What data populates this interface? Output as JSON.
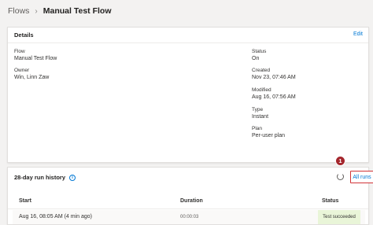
{
  "breadcrumb": {
    "root": "Flows",
    "separator": "›",
    "current": "Manual Test Flow"
  },
  "details": {
    "title": "Details",
    "edit_label": "Edit",
    "flow_label": "Flow",
    "flow_value": "Manual Test Flow",
    "owner_label": "Owner",
    "owner_value": "Win, Linn Zaw",
    "status_label": "Status",
    "status_value": "On",
    "created_label": "Created",
    "created_value": "Nov 23, 07:46 AM",
    "modified_label": "Modified",
    "modified_value": "Aug 16, 07:56 AM",
    "type_label": "Type",
    "type_value": "Instant",
    "plan_label": "Plan",
    "plan_value": "Per-user plan"
  },
  "history": {
    "title": "28-day run history",
    "info_glyph": "i",
    "all_runs_label": "All runs",
    "step_badge": "1",
    "columns": {
      "start": "Start",
      "duration": "Duration",
      "status": "Status"
    },
    "rows": [
      {
        "start": "Aug 16, 08:05 AM (4 min ago)",
        "duration": "00:00:03",
        "status": "Test succeeded"
      }
    ]
  },
  "colors": {
    "accent": "#0078d4",
    "highlight_border": "#d13438",
    "badge": "#a4262c",
    "success_bg": "#e9f5d8"
  }
}
